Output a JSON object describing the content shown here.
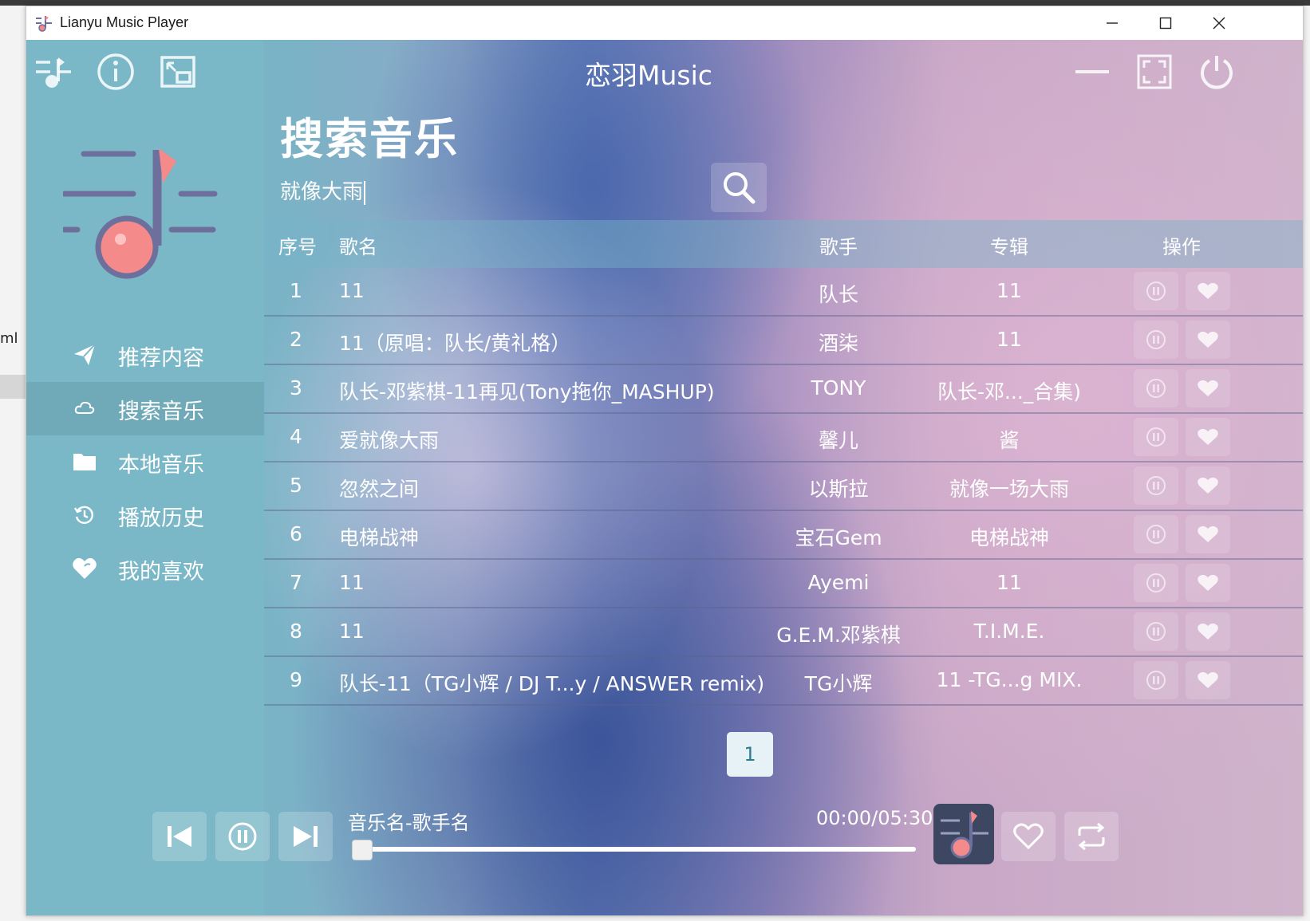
{
  "window": {
    "title": "Lianyu Music Player"
  },
  "desktop": {
    "side_text": "ml"
  },
  "header": {
    "brand": "恋羽Music"
  },
  "page": {
    "title": "搜索音乐"
  },
  "search": {
    "value": "就像大雨"
  },
  "sidebar": {
    "items": [
      {
        "label": "推荐内容",
        "icon": "paper-plane-icon"
      },
      {
        "label": "搜索音乐",
        "icon": "cloud-icon",
        "active": true
      },
      {
        "label": "本地音乐",
        "icon": "folder-icon"
      },
      {
        "label": "播放历史",
        "icon": "history-icon"
      },
      {
        "label": "我的喜欢",
        "icon": "heart-icon"
      }
    ]
  },
  "table": {
    "headers": {
      "index": "序号",
      "name": "歌名",
      "singer": "歌手",
      "album": "专辑",
      "op": "操作"
    },
    "rows": [
      {
        "index": "1",
        "name": "11",
        "singer": "队长",
        "album": "11"
      },
      {
        "index": "2",
        "name": "11（原唱：队长/黄礼格）",
        "singer": "酒柒",
        "album": "11"
      },
      {
        "index": "3",
        "name": "队长-邓紫棋-11再见(Tony拖你_MASHUP)",
        "singer": "TONY",
        "album": "队长-邓..._合集)"
      },
      {
        "index": "4",
        "name": "爱就像大雨",
        "singer": "馨儿",
        "album": "酱"
      },
      {
        "index": "5",
        "name": "忽然之间",
        "singer": "以斯拉",
        "album": "就像一场大雨"
      },
      {
        "index": "6",
        "name": "电梯战神",
        "singer": "宝石Gem",
        "album": "电梯战神"
      },
      {
        "index": "7",
        "name": "11",
        "singer": "Ayemi",
        "album": "11"
      },
      {
        "index": "8",
        "name": "11",
        "singer": "G.E.M.邓紫棋",
        "album": "T.I.M.E."
      },
      {
        "index": "9",
        "name": "队长-11（TG小辉 / DJ T...y / ANSWER remix)",
        "singer": "TG小辉",
        "album": "11 -TG...g MIX."
      }
    ]
  },
  "pagination": {
    "current": "1"
  },
  "player": {
    "now_playing": "音乐名-歌手名",
    "time": "00:00/05:30",
    "progress": 0.0
  },
  "colors": {
    "sidebar": "#7ab8c7",
    "accent": "#f48a8a",
    "note_dark": "#6d6f9c"
  }
}
